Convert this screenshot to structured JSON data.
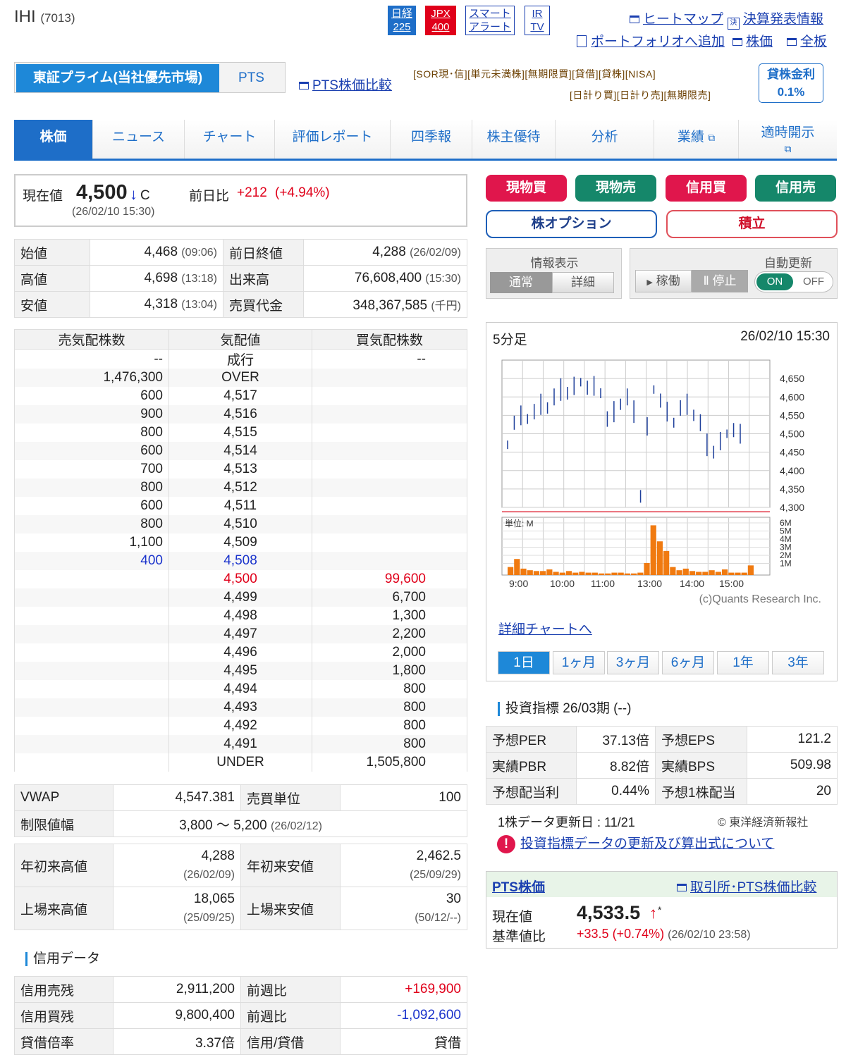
{
  "header": {
    "name": "IHI",
    "code": "(7013)",
    "badges": [
      {
        "l1": "日経",
        "l2": "225"
      },
      {
        "l1": "JPX",
        "l2": "400"
      },
      {
        "l1": "スマート",
        "l2": "アラート"
      },
      {
        "l1": "IR",
        "l2": "TV"
      }
    ],
    "links": [
      "ヒートマップ",
      "決算発表情報",
      "ポートフォリオへ追加",
      "株価",
      "全板"
    ]
  },
  "market": {
    "primary": "東証プライム(当社優先市場)",
    "pts": "PTS",
    "pts_compare": "PTS株価比較",
    "tags1": "[SOR現･信][単元未満株][無期限買][貸借][貸株][NISA]",
    "tags2": "[日計り買][日計り売][無期限売]",
    "kashi_label": "貸株金利",
    "kashi_rate": "0.1%"
  },
  "nav": [
    "株価",
    "ニュース",
    "チャート",
    "評価レポート",
    "四季報",
    "株主優待",
    "分析",
    "業績",
    "適時開示"
  ],
  "price": {
    "label": "現在値",
    "value": "4,500",
    "arrow": "↓",
    "flag": "C",
    "time": "(26/02/10 15:30)",
    "chg_label": "前日比",
    "chg": "+212",
    "chg_pct": "(+4.94%)"
  },
  "stats": [
    {
      "l": "始値",
      "v": "4,468",
      "t": "(09:06)",
      "l2": "前日終値",
      "v2": "4,288",
      "t2": "(26/02/09)"
    },
    {
      "l": "高値",
      "v": "4,698",
      "t": "(13:18)",
      "l2": "出来高",
      "v2": "76,608,400",
      "t2": "(15:30)"
    },
    {
      "l": "安値",
      "v": "4,318",
      "t": "(13:04)",
      "l2": "売買代金",
      "v2": "348,367,585",
      "t2": "(千円)"
    }
  ],
  "orderbook": {
    "headers": [
      "売気配株数",
      "気配値",
      "買気配株数"
    ],
    "rows": [
      [
        "--",
        "成行",
        "--"
      ],
      [
        "1,476,300",
        "OVER",
        ""
      ],
      [
        "600",
        "4,517",
        ""
      ],
      [
        "900",
        "4,516",
        ""
      ],
      [
        "800",
        "4,515",
        ""
      ],
      [
        "600",
        "4,514",
        ""
      ],
      [
        "700",
        "4,513",
        ""
      ],
      [
        "800",
        "4,512",
        ""
      ],
      [
        "600",
        "4,511",
        ""
      ],
      [
        "800",
        "4,510",
        ""
      ],
      [
        "1,100",
        "4,509",
        ""
      ],
      [
        "400",
        "4,508",
        ""
      ],
      [
        "",
        "4,500",
        "99,600"
      ],
      [
        "",
        "4,499",
        "6,700"
      ],
      [
        "",
        "4,498",
        "1,300"
      ],
      [
        "",
        "4,497",
        "2,200"
      ],
      [
        "",
        "4,496",
        "2,000"
      ],
      [
        "",
        "4,495",
        "1,800"
      ],
      [
        "",
        "4,494",
        "800"
      ],
      [
        "",
        "4,493",
        "800"
      ],
      [
        "",
        "4,492",
        "800"
      ],
      [
        "",
        "4,491",
        "800"
      ],
      [
        "",
        "UNDER",
        "1,505,800"
      ]
    ]
  },
  "vwap": {
    "l": "VWAP",
    "v": "4,547.381",
    "l2": "売買単位",
    "v2": "100",
    "lim_l": "制限値幅",
    "lim_v": "3,800 〜 5,200",
    "lim_t": "(26/02/12)"
  },
  "records": [
    {
      "l": "年初来高値",
      "v": "4,288",
      "t": "(26/02/09)",
      "l2": "年初来安値",
      "v2": "2,462.5",
      "t2": "(25/09/29)"
    },
    {
      "l": "上場来高値",
      "v": "18,065",
      "t": "(25/09/25)",
      "l2": "上場来安値",
      "v2": "30",
      "t2": "(50/12/--)"
    }
  ],
  "margin": {
    "title": "信用データ",
    "rows": [
      {
        "l": "信用売残",
        "v": "2,911,200",
        "l2": "前週比",
        "v2": "+169,900"
      },
      {
        "l": "信用買残",
        "v": "9,800,400",
        "l2": "前週比",
        "v2": "-1,092,600"
      },
      {
        "l": "貸借倍率",
        "v": "3.37倍",
        "l2": "信用/貸借",
        "v2": "貸借"
      }
    ]
  },
  "trade": {
    "buy": "現物買",
    "sell": "現物売",
    "mbuy": "信用買",
    "msell": "信用売",
    "option": "株オプション",
    "tsumitate": "積立",
    "colors": {
      "buy": "#e0164c",
      "sell": "#15876a"
    }
  },
  "display": {
    "title": "情報表示",
    "normal": "通常",
    "detail": "詳細",
    "auto": "自動更新",
    "run": "稼働",
    "stop": "停止",
    "on": "ON",
    "off": "OFF"
  },
  "chart": {
    "label": "5分足",
    "time": "26/02/10 15:30",
    "unit": "単位: M",
    "credit": "(c)Quants Research Inc.",
    "link": "詳細チャートへ",
    "periods": [
      "1日",
      "1ヶ月",
      "3ヶ月",
      "6ヶ月",
      "1年",
      "3年"
    ]
  },
  "chart_data": {
    "type": "line",
    "x": [
      "9:00",
      "10:00",
      "11:00",
      "13:00",
      "14:00",
      "15:00"
    ],
    "price_ticks": [
      "4,650",
      "4,600",
      "4,550",
      "4,500",
      "4,450",
      "4,400",
      "4,350",
      "4,300"
    ],
    "volume_ticks": [
      "6M",
      "5M",
      "4M",
      "3M",
      "2M",
      "1M"
    ],
    "price": [
      4470,
      4530,
      4550,
      4540,
      4560,
      4580,
      4570,
      4600,
      4620,
      4610,
      4630,
      4640,
      4625,
      4630,
      4610,
      4540,
      4560,
      4580,
      4600,
      4560,
      4330,
      4520,
      4620,
      4590,
      4560,
      4530,
      4570,
      4580,
      4550,
      4530,
      4470,
      4450,
      4480,
      4500,
      4510,
      4500
    ],
    "volume": [
      1.0,
      2.0,
      0.8,
      0.6,
      0.5,
      0.5,
      0.7,
      0.4,
      0.3,
      0.5,
      0.3,
      0.4,
      0.3,
      0.3,
      0.2,
      0.2,
      0.3,
      0.3,
      0.2,
      0.2,
      0.3,
      1.5,
      6.2,
      4.2,
      3.0,
      1.0,
      0.6,
      0.8,
      0.5,
      0.4,
      0.4,
      0.6,
      0.4,
      0.7,
      0.3,
      0.3,
      0.3,
      1.2
    ],
    "ylim": [
      4300,
      4700
    ]
  },
  "indicators": {
    "title": "投資指標 26/03期 (--)",
    "rows": [
      {
        "l": "予想PER",
        "v": "37.13倍",
        "l2": "予想EPS",
        "v2": "121.2"
      },
      {
        "l": "実績PBR",
        "v": "8.82倍",
        "l2": "実績BPS",
        "v2": "509.98"
      },
      {
        "l": "予想配当利",
        "v": "0.44%",
        "l2": "予想1株配当",
        "v2": "20"
      }
    ],
    "update": "1株データ更新日 : 11/21",
    "source": "© 東洋経済新報社",
    "notice": "投資指標データの更新及び算出式について"
  },
  "pts": {
    "title": "PTS株価",
    "compare": "取引所･PTS株価比較",
    "price_l": "現在値",
    "price": "4,533.5",
    "arrow": "↑",
    "star": "*",
    "chg_l": "基準値比",
    "chg": "+33.5",
    "pct": "(+0.74%)",
    "time": "(26/02/10 23:58)"
  }
}
